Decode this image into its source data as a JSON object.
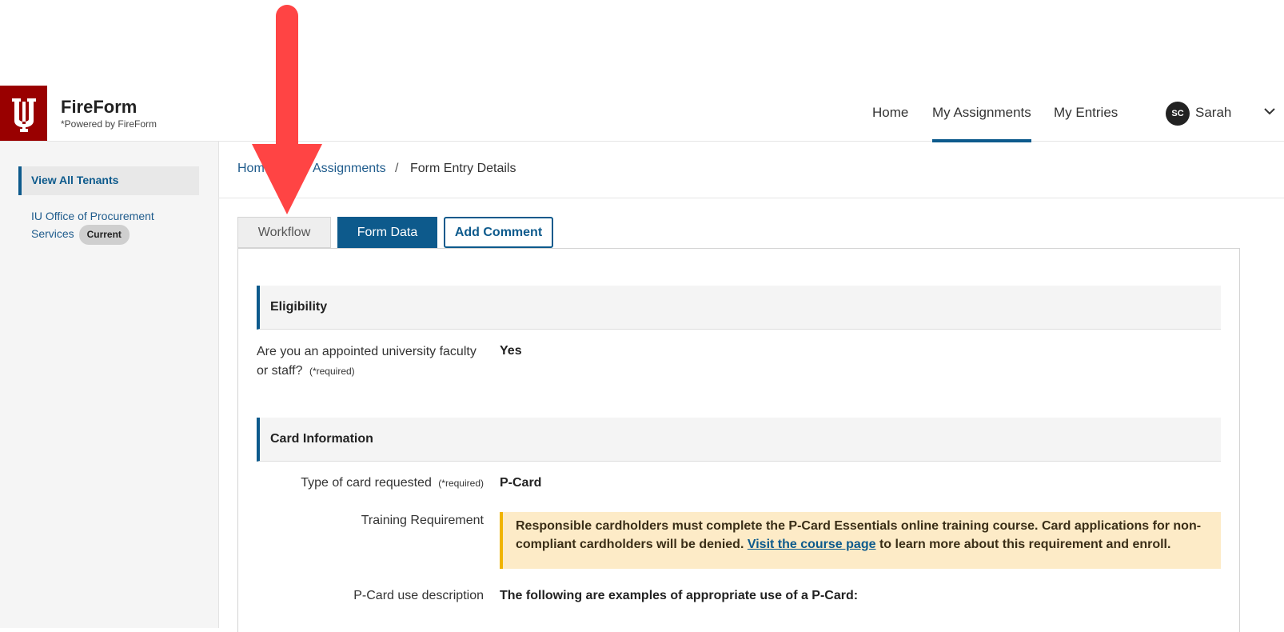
{
  "brand": {
    "title": "FireForm",
    "subtitle": "*Powered by FireForm"
  },
  "nav": {
    "home": "Home",
    "assignments": "My Assignments",
    "entries": "My Entries"
  },
  "user": {
    "initials": "SC",
    "name": "Sarah"
  },
  "sidebar": {
    "view_all": "View All Tenants",
    "tenant": "IU Office of Procurement Services",
    "tenant_badge": "Current"
  },
  "breadcrumb": {
    "home": "Home",
    "assignments": "Assignments",
    "sep": "/",
    "current": "Form Entry Details"
  },
  "tabs": {
    "workflow": "Workflow",
    "form_data": "Form Data",
    "add_comment": "Add Comment"
  },
  "sections": {
    "eligibility": {
      "title": "Eligibility",
      "question": "Are you an appointed university faculty or staff?",
      "required": "(*required)",
      "answer": "Yes"
    },
    "card": {
      "title": "Card Information",
      "type_label": "Type of card requested",
      "required": "(*required)",
      "type_answer": "P-Card",
      "training_label": "Training Requirement",
      "notice_before": "Responsible cardholders must complete the P-Card Essentials online training course. Card applications for non-compliant cardholders will be denied. ",
      "notice_link": "Visit the course page",
      "notice_after": " to learn more about this requirement and enroll.",
      "use_label": "P-Card use description",
      "use_text": "The following are examples of appropriate use of a P-Card:"
    }
  },
  "colors": {
    "brand_red": "#990000",
    "accent_blue": "#0d5a8c",
    "arrow": "#ff4444",
    "notice_bg": "#fdebc7"
  },
  "icons": {
    "logo": "iu-trident-icon",
    "user_menu": "chevron-down-icon",
    "annotation": "arrow-down-icon"
  }
}
